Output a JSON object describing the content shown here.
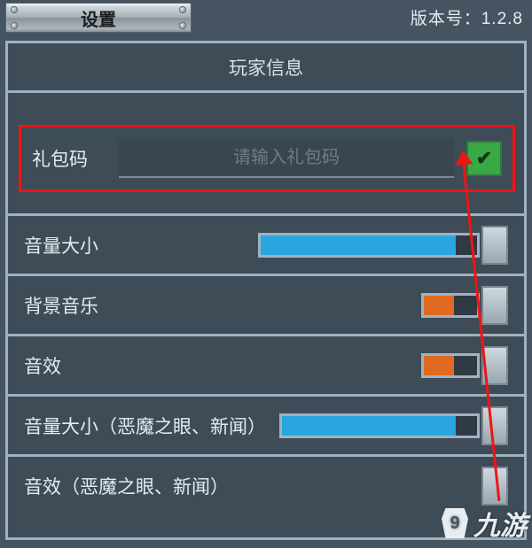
{
  "header": {
    "settings_label": "设置",
    "version_prefix": "版本号：",
    "version": "1.2.8"
  },
  "panel": {
    "player_info_title": "玩家信息"
  },
  "gift": {
    "label": "礼包码",
    "placeholder": "请输入礼包码",
    "confirm_icon": "✔"
  },
  "sliders": {
    "volume": {
      "label": "音量大小",
      "track_width": 250,
      "fill_width": 220,
      "fill_color": "blue"
    },
    "bgm": {
      "label": "背景音乐",
      "track_width": 66,
      "fill_width": 34,
      "fill_color": "orange"
    },
    "sfx": {
      "label": "音效",
      "track_width": 66,
      "fill_width": 34,
      "fill_color": "orange"
    },
    "volume_sub": {
      "label": "音量大小（恶魔之眼、新闻）",
      "track_width": 226,
      "fill_width": 196,
      "fill_color": "blue"
    },
    "sfx_sub": {
      "label": "音效（恶魔之眼、新闻）",
      "track_width": 0,
      "fill_width": 0,
      "fill_color": "none"
    }
  },
  "watermark": {
    "text": "九游",
    "badge": "9"
  }
}
